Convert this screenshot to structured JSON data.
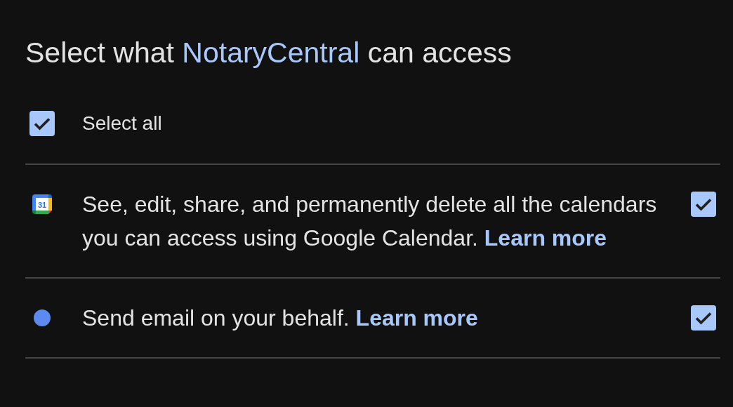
{
  "title": {
    "prefix": "Select what ",
    "app_name": "NotaryCentral",
    "suffix": " can access"
  },
  "select_all": {
    "label": "Select all",
    "checked": true
  },
  "permissions": [
    {
      "kind": "calendar",
      "icon_text": "31",
      "text": "See, edit, share, and permanently delete all the calendars you can access using Google Calendar. ",
      "link": "Learn more",
      "checked": true
    },
    {
      "kind": "dot",
      "color": "#5b8af0",
      "text": "Send email on your behalf. ",
      "link": "Learn more",
      "checked": true
    }
  ]
}
